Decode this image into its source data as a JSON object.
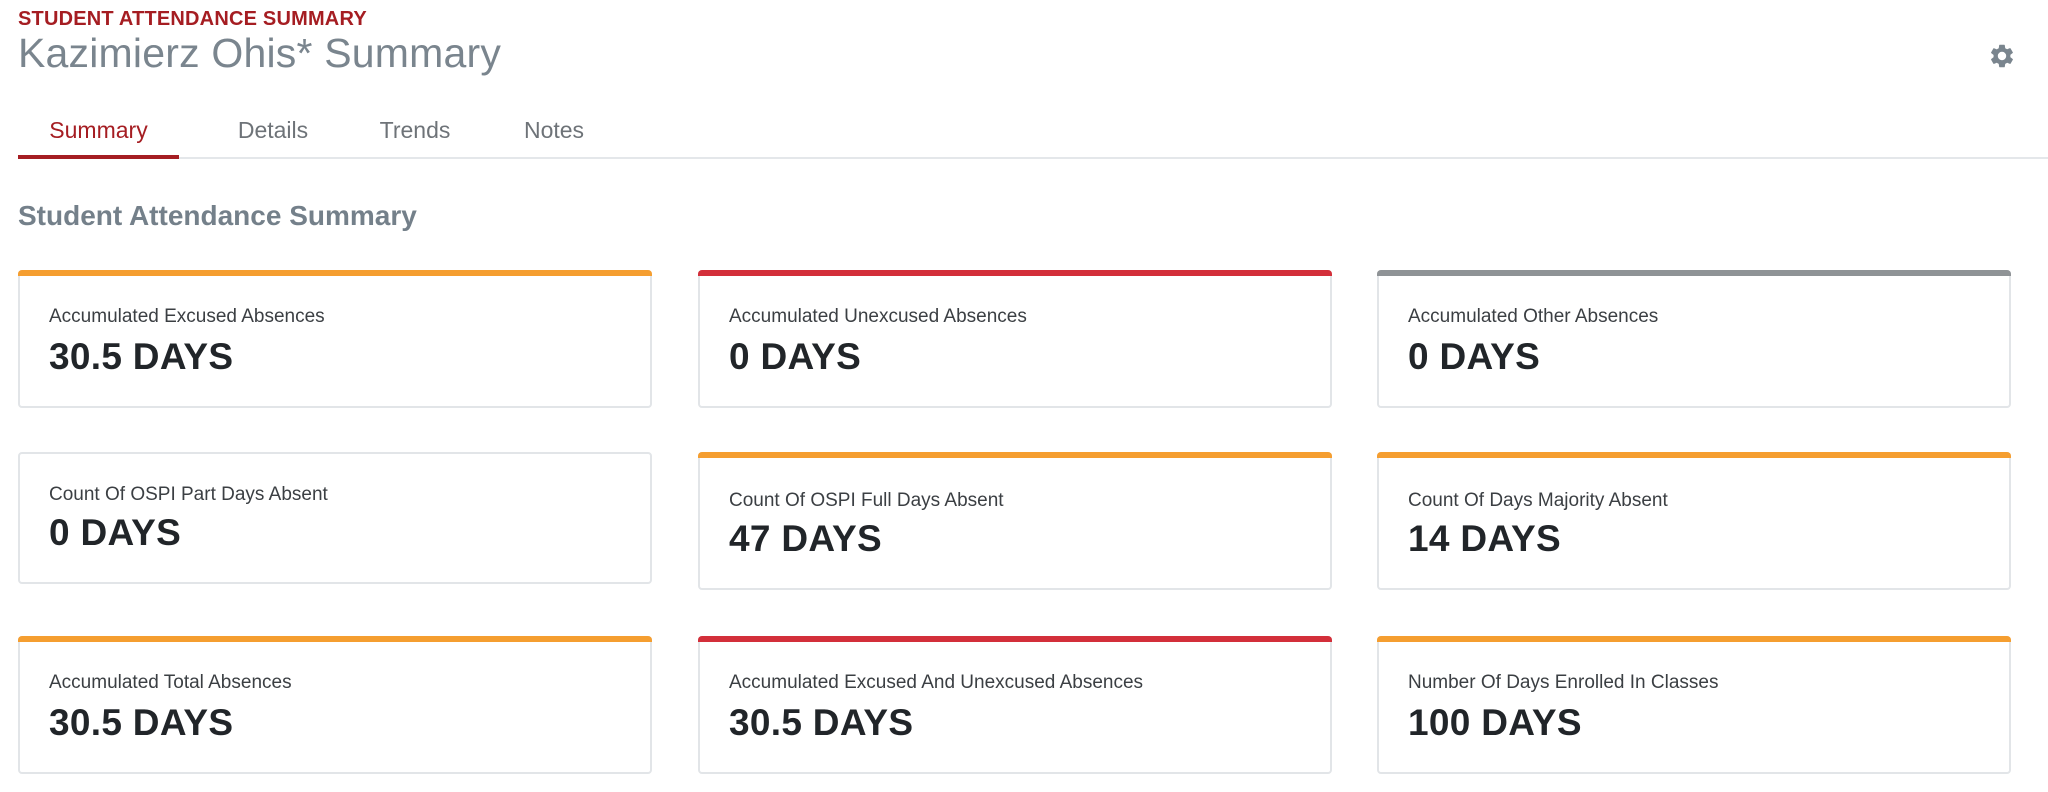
{
  "header": {
    "eyebrow": "STUDENT ATTENDANCE SUMMARY",
    "title": "Kazimierz Ohis* Summary",
    "settings_icon": "gear-icon"
  },
  "tabs": [
    {
      "label": "Summary",
      "active": true
    },
    {
      "label": "Details",
      "active": false
    },
    {
      "label": "Trends",
      "active": false
    },
    {
      "label": "Notes",
      "active": false
    }
  ],
  "section": {
    "title": "Student Attendance Summary"
  },
  "colors": {
    "accent": "#a51d22",
    "orange": "#f59e30",
    "red": "#d32f3a",
    "gray": "#8f9396"
  },
  "cards": [
    {
      "label": "Accumulated Excused Absences",
      "value": "30.5 DAYS",
      "status": "orange"
    },
    {
      "label": "Accumulated Unexcused Absences",
      "value": "0 DAYS",
      "status": "red"
    },
    {
      "label": "Accumulated Other Absences",
      "value": "0 DAYS",
      "status": "gray"
    },
    {
      "label": "Count Of OSPI Part Days Absent",
      "value": "0 DAYS",
      "status": "none"
    },
    {
      "label": "Count Of OSPI Full Days Absent",
      "value": "47 DAYS",
      "status": "orange"
    },
    {
      "label": "Count Of Days Majority Absent",
      "value": "14 DAYS",
      "status": "orange"
    },
    {
      "label": "Accumulated Total Absences",
      "value": "30.5 DAYS",
      "status": "orange"
    },
    {
      "label": "Accumulated Excused And Unexcused Absences",
      "value": "30.5 DAYS",
      "status": "red"
    },
    {
      "label": "Number Of Days Enrolled In Classes",
      "value": "100 DAYS",
      "status": "orange"
    }
  ]
}
